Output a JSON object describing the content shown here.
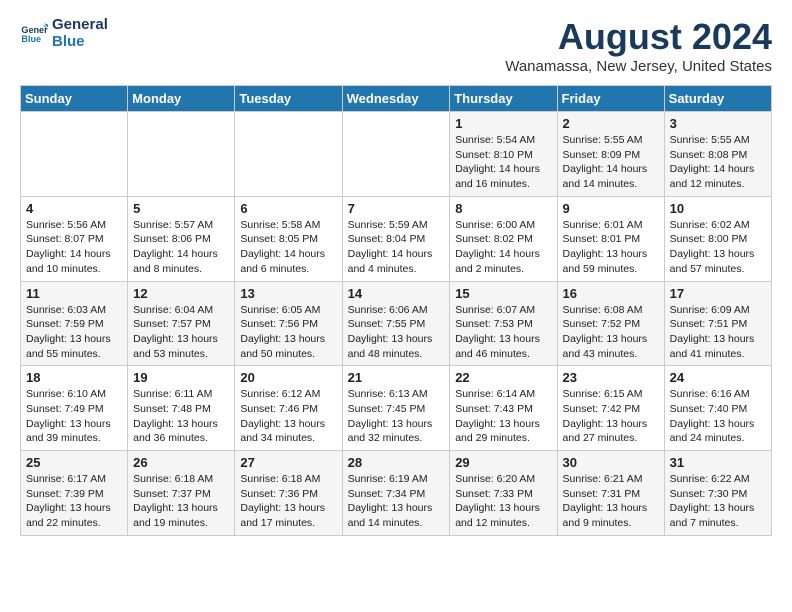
{
  "logo": {
    "line1": "General",
    "line2": "Blue"
  },
  "title": "August 2024",
  "location": "Wanamassa, New Jersey, United States",
  "weekdays": [
    "Sunday",
    "Monday",
    "Tuesday",
    "Wednesday",
    "Thursday",
    "Friday",
    "Saturday"
  ],
  "weeks": [
    [
      {
        "day": "",
        "detail": ""
      },
      {
        "day": "",
        "detail": ""
      },
      {
        "day": "",
        "detail": ""
      },
      {
        "day": "",
        "detail": ""
      },
      {
        "day": "1",
        "detail": "Sunrise: 5:54 AM\nSunset: 8:10 PM\nDaylight: 14 hours\nand 16 minutes."
      },
      {
        "day": "2",
        "detail": "Sunrise: 5:55 AM\nSunset: 8:09 PM\nDaylight: 14 hours\nand 14 minutes."
      },
      {
        "day": "3",
        "detail": "Sunrise: 5:55 AM\nSunset: 8:08 PM\nDaylight: 14 hours\nand 12 minutes."
      }
    ],
    [
      {
        "day": "4",
        "detail": "Sunrise: 5:56 AM\nSunset: 8:07 PM\nDaylight: 14 hours\nand 10 minutes."
      },
      {
        "day": "5",
        "detail": "Sunrise: 5:57 AM\nSunset: 8:06 PM\nDaylight: 14 hours\nand 8 minutes."
      },
      {
        "day": "6",
        "detail": "Sunrise: 5:58 AM\nSunset: 8:05 PM\nDaylight: 14 hours\nand 6 minutes."
      },
      {
        "day": "7",
        "detail": "Sunrise: 5:59 AM\nSunset: 8:04 PM\nDaylight: 14 hours\nand 4 minutes."
      },
      {
        "day": "8",
        "detail": "Sunrise: 6:00 AM\nSunset: 8:02 PM\nDaylight: 14 hours\nand 2 minutes."
      },
      {
        "day": "9",
        "detail": "Sunrise: 6:01 AM\nSunset: 8:01 PM\nDaylight: 13 hours\nand 59 minutes."
      },
      {
        "day": "10",
        "detail": "Sunrise: 6:02 AM\nSunset: 8:00 PM\nDaylight: 13 hours\nand 57 minutes."
      }
    ],
    [
      {
        "day": "11",
        "detail": "Sunrise: 6:03 AM\nSunset: 7:59 PM\nDaylight: 13 hours\nand 55 minutes."
      },
      {
        "day": "12",
        "detail": "Sunrise: 6:04 AM\nSunset: 7:57 PM\nDaylight: 13 hours\nand 53 minutes."
      },
      {
        "day": "13",
        "detail": "Sunrise: 6:05 AM\nSunset: 7:56 PM\nDaylight: 13 hours\nand 50 minutes."
      },
      {
        "day": "14",
        "detail": "Sunrise: 6:06 AM\nSunset: 7:55 PM\nDaylight: 13 hours\nand 48 minutes."
      },
      {
        "day": "15",
        "detail": "Sunrise: 6:07 AM\nSunset: 7:53 PM\nDaylight: 13 hours\nand 46 minutes."
      },
      {
        "day": "16",
        "detail": "Sunrise: 6:08 AM\nSunset: 7:52 PM\nDaylight: 13 hours\nand 43 minutes."
      },
      {
        "day": "17",
        "detail": "Sunrise: 6:09 AM\nSunset: 7:51 PM\nDaylight: 13 hours\nand 41 minutes."
      }
    ],
    [
      {
        "day": "18",
        "detail": "Sunrise: 6:10 AM\nSunset: 7:49 PM\nDaylight: 13 hours\nand 39 minutes."
      },
      {
        "day": "19",
        "detail": "Sunrise: 6:11 AM\nSunset: 7:48 PM\nDaylight: 13 hours\nand 36 minutes."
      },
      {
        "day": "20",
        "detail": "Sunrise: 6:12 AM\nSunset: 7:46 PM\nDaylight: 13 hours\nand 34 minutes."
      },
      {
        "day": "21",
        "detail": "Sunrise: 6:13 AM\nSunset: 7:45 PM\nDaylight: 13 hours\nand 32 minutes."
      },
      {
        "day": "22",
        "detail": "Sunrise: 6:14 AM\nSunset: 7:43 PM\nDaylight: 13 hours\nand 29 minutes."
      },
      {
        "day": "23",
        "detail": "Sunrise: 6:15 AM\nSunset: 7:42 PM\nDaylight: 13 hours\nand 27 minutes."
      },
      {
        "day": "24",
        "detail": "Sunrise: 6:16 AM\nSunset: 7:40 PM\nDaylight: 13 hours\nand 24 minutes."
      }
    ],
    [
      {
        "day": "25",
        "detail": "Sunrise: 6:17 AM\nSunset: 7:39 PM\nDaylight: 13 hours\nand 22 minutes."
      },
      {
        "day": "26",
        "detail": "Sunrise: 6:18 AM\nSunset: 7:37 PM\nDaylight: 13 hours\nand 19 minutes."
      },
      {
        "day": "27",
        "detail": "Sunrise: 6:18 AM\nSunset: 7:36 PM\nDaylight: 13 hours\nand 17 minutes."
      },
      {
        "day": "28",
        "detail": "Sunrise: 6:19 AM\nSunset: 7:34 PM\nDaylight: 13 hours\nand 14 minutes."
      },
      {
        "day": "29",
        "detail": "Sunrise: 6:20 AM\nSunset: 7:33 PM\nDaylight: 13 hours\nand 12 minutes."
      },
      {
        "day": "30",
        "detail": "Sunrise: 6:21 AM\nSunset: 7:31 PM\nDaylight: 13 hours\nand 9 minutes."
      },
      {
        "day": "31",
        "detail": "Sunrise: 6:22 AM\nSunset: 7:30 PM\nDaylight: 13 hours\nand 7 minutes."
      }
    ]
  ]
}
